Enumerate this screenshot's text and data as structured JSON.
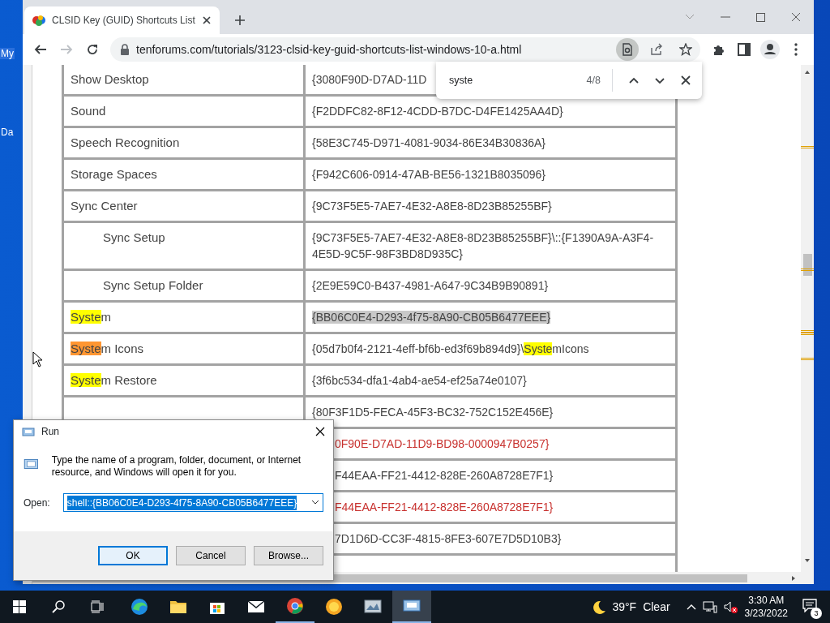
{
  "desktop": {
    "icon_labels": [
      "My",
      "Da"
    ]
  },
  "browser": {
    "tab": {
      "title": "CLSID Key (GUID) Shortcuts List"
    },
    "address": "tenforums.com/tutorials/3123-clsid-key-guid-shortcuts-list-windows-10-a.html",
    "find_bar": {
      "query": "syste",
      "count": "4/8"
    },
    "table": {
      "rows": [
        {
          "name": [
            {
              "text": "Show Desktop"
            }
          ],
          "guid": [
            {
              "text": "{3080F90D-D7AD-11D"
            }
          ],
          "selected": false,
          "color": "#444444"
        },
        {
          "name": [
            {
              "text": "Sound"
            }
          ],
          "guid": [
            {
              "text": "{F2DDFC82-8F12-4CDD-B7DC-D4FE1425AA4D}"
            }
          ],
          "selected": false,
          "color": "#444444"
        },
        {
          "name": [
            {
              "text": "Speech Recognition"
            }
          ],
          "guid": [
            {
              "text": "{58E3C745-D971-4081-9034-86E34B30836A}"
            }
          ],
          "selected": false,
          "color": "#444444"
        },
        {
          "name": [
            {
              "text": "Storage Spaces"
            }
          ],
          "guid": [
            {
              "text": "{F942C606-0914-47AB-BE56-1321B8035096}"
            }
          ],
          "selected": false,
          "color": "#444444"
        },
        {
          "name": [
            {
              "text": "Sync Center"
            }
          ],
          "guid": [
            {
              "text": "{9C73F5E5-7AE7-4E32-A8E8-8D23B85255BF}"
            }
          ],
          "selected": false,
          "color": "#444444",
          "children": [
            {
              "name": [
                {
                  "text": "Sync Setup"
                }
              ],
              "guid": [
                {
                  "text": "{9C73F5E5-7AE7-4E32-A8E8-8D23B85255BF}\\::{F1390A9A-A3F4-4E5D-9C5F-98F3BD8D935C}"
                }
              ],
              "selected": false,
              "color": "#444444"
            },
            {
              "name": [
                {
                  "text": "Sync Setup Folder"
                }
              ],
              "guid": [
                {
                  "text": "{2E9E59C0-B437-4981-A647-9C34B9B90891}"
                }
              ],
              "selected": false,
              "color": "#444444"
            }
          ]
        },
        {
          "name": [
            {
              "text": "Syste",
              "highlighted": true,
              "current": false
            },
            {
              "text": "m"
            }
          ],
          "guid": [
            {
              "text": "{BB06C0E4-D293-4f75-8A90-CB05B6477EEE}"
            }
          ],
          "selected": true,
          "color": "#444444"
        },
        {
          "name": [
            {
              "text": "Syste",
              "highlighted": true,
              "current": true
            },
            {
              "text": "m Icons"
            }
          ],
          "guid": [
            {
              "text": "{05d7b0f4-2121-4eff-bf6b-ed3f69b894d9}\\"
            },
            {
              "text": "Syste",
              "highlighted": true,
              "current": false
            },
            {
              "text": "mIcons"
            }
          ],
          "selected": false,
          "color": "#444444"
        },
        {
          "name": [
            {
              "text": "Syste",
              "highlighted": true,
              "current": false
            },
            {
              "text": "m Restore"
            }
          ],
          "guid": [
            {
              "text": "{3f6bc534-dfa1-4ab4-ae54-ef25a74e0107}"
            }
          ],
          "selected": false,
          "color": "#444444"
        },
        {
          "guid": [
            {
              "text": "{80F3F1D5-FECA-45F3-BC32-752C152E456E}"
            }
          ],
          "selected": false,
          "color": "#444444"
        },
        {
          "guid": [
            {
              "text": "0F90E-D7AD-11D9-BD98-0000947B0257}"
            }
          ],
          "clipped": true,
          "selected": false,
          "color": "#c8312e"
        },
        {
          "guid": [
            {
              "text": "F44EAA-FF21-4412-828E-260A8728E7F1}"
            }
          ],
          "clipped": true,
          "selected": false,
          "color": "#444444"
        },
        {
          "guid": [
            {
              "text": "F44EAA-FF21-4412-828E-260A8728E7F1}"
            }
          ],
          "clipped": true,
          "selected": false,
          "color": "#c8312e"
        },
        {
          "guid": [
            {
              "text": "7D1D6D-CC3F-4815-8FE3-607E7D5D10B3}"
            }
          ],
          "clipped": true,
          "selected": false,
          "color": "#444444"
        }
      ]
    }
  },
  "run_dialog": {
    "title": "Run",
    "message": "Type the name of a program, folder, document, or Internet resource, and Windows will open it for you.",
    "open_label": "Open:",
    "value": "shell::{BB06C0E4-D293-4f75-8A90-CB05B6477EEE}",
    "value_selected": true,
    "buttons": [
      {
        "label": "OK",
        "default": true
      },
      {
        "label": "Cancel",
        "default": false
      },
      {
        "label": "Browse...",
        "default": false
      }
    ]
  },
  "taskbar": {
    "items": [
      {
        "kind": "start",
        "running": false,
        "active": false
      },
      {
        "kind": "search",
        "running": false,
        "active": false
      },
      {
        "kind": "taskview",
        "running": false,
        "active": false
      },
      {
        "kind": "edge",
        "running": false,
        "active": false
      },
      {
        "kind": "explorer",
        "running": false,
        "active": false
      },
      {
        "kind": "store",
        "running": false,
        "active": false
      },
      {
        "kind": "mail",
        "running": false,
        "active": false
      },
      {
        "kind": "chrome",
        "running": true,
        "active": false
      },
      {
        "kind": "ring",
        "running": false,
        "active": false
      },
      {
        "kind": "monitor",
        "running": false,
        "active": false
      },
      {
        "kind": "run",
        "running": true,
        "active": true
      }
    ],
    "weather": {
      "temp": "39°F",
      "condition": "Clear"
    },
    "time": "3:30 AM",
    "date": "3/23/2022",
    "notifications": "3"
  }
}
